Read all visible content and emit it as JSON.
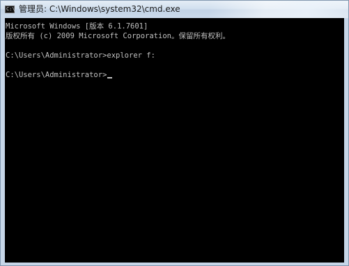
{
  "window": {
    "title": "管理员: C:\\Windows\\system32\\cmd.exe",
    "icon": "cmd-icon",
    "icon_glyph": "C:\\"
  },
  "console": {
    "lines": [
      "Microsoft Windows [版本 6.1.7601]",
      "版权所有 (c) 2009 Microsoft Corporation。保留所有权利。",
      "",
      "C:\\Users\\Administrator>explorer f:",
      "",
      "C:\\Users\\Administrator>"
    ],
    "text_color": "#c0c0c0",
    "background_color": "#000000"
  }
}
